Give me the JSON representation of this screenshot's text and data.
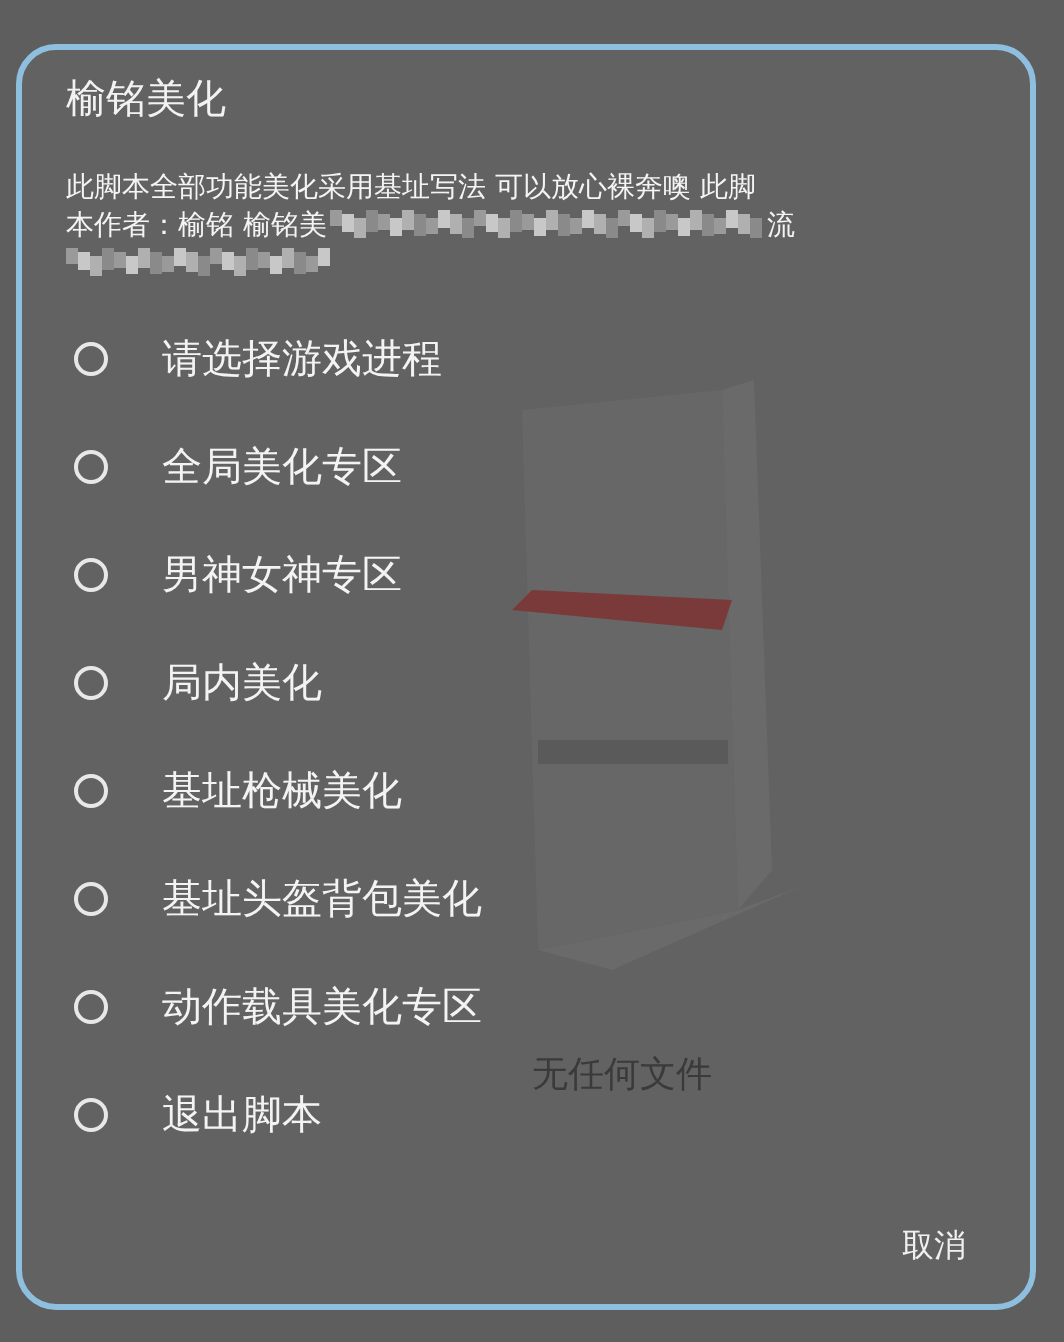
{
  "dialog": {
    "title": "榆铭美化",
    "message": {
      "line_1": "此脚本全部功能美化采用基址写法 可以放心裸奔噢 此脚",
      "line_2": "本作者：榆铭 榆铭美",
      "tail": "流"
    },
    "options": [
      {
        "label": "请选择游戏进程",
        "selected": false
      },
      {
        "label": "全局美化专区",
        "selected": false
      },
      {
        "label": "男神女神专区",
        "selected": false
      },
      {
        "label": "局内美化",
        "selected": false
      },
      {
        "label": "基址枪械美化",
        "selected": false
      },
      {
        "label": "基址头盔背包美化",
        "selected": false
      },
      {
        "label": "动作载具美化专区",
        "selected": false
      },
      {
        "label": "退出脚本",
        "selected": false
      }
    ],
    "cancel_button": "取消"
  },
  "background": {
    "empty_text": "无任何文件"
  }
}
